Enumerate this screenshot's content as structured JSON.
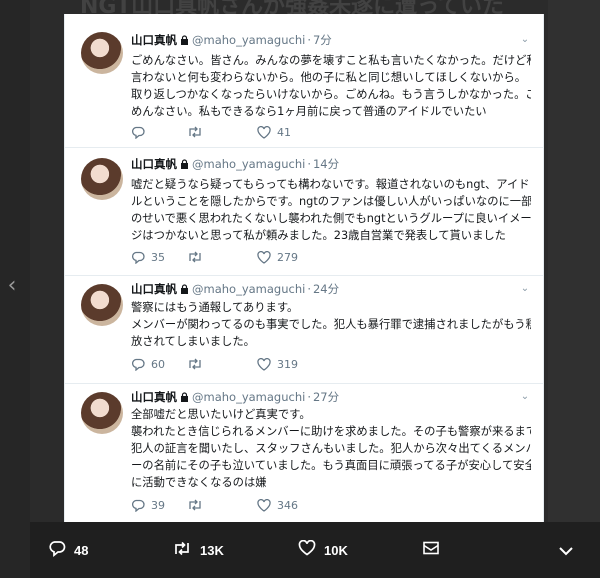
{
  "background": {
    "header_text": "NGT山口真帆さんが強姦未遂に遭っていた"
  },
  "tweets": [
    {
      "name": "山口真帆",
      "handle": "@maho_yamaguchi",
      "time": "7分",
      "lines": [
        "ごめんなさい。皆さん。みんなの夢を壊すこと私も言いたくなかった。だけど私が",
        "言わないと何も変わらないから。他の子に私と同じ想いしてほしくないから。",
        "取り返しつかなくなったらいけないから。ごめんね。もう言うしかなかった。ご",
        "めんなさい。私もできるなら1ヶ月前に戻って普通のアイドルでいたい"
      ],
      "replies": "",
      "retweets": "",
      "likes": "41"
    },
    {
      "name": "山口真帆",
      "handle": "@maho_yamaguchi",
      "time": "14分",
      "lines": [
        "嘘だと疑うなら疑ってもらっても構わないです。報道されないのもngt、アイド",
        "ルということを隠したからです。ngtのファンは優しい人がいっぱいなのに一部",
        "のせいで悪く思われたくないし襲われた側でもngtというグループに良いイメー",
        "ジはつかないと思って私が頼みました。23歳自営業で発表して貰いました"
      ],
      "replies": "35",
      "retweets": "",
      "likes": "279"
    },
    {
      "name": "山口真帆",
      "handle": "@maho_yamaguchi",
      "time": "24分",
      "lines": [
        "警察にはもう通報してあります。",
        "メンバーが関わってるのも事実でした。犯人も暴行罪で逮捕されましたがもう釈",
        "放されてしまいました。"
      ],
      "replies": "60",
      "retweets": "",
      "likes": "319"
    },
    {
      "name": "山口真帆",
      "handle": "@maho_yamaguchi",
      "time": "27分",
      "lines": [
        "全部嘘だと思いたいけど真実です。",
        "襲われたとき信じられるメンバーに助けを求めました。その子も警察が来るまで",
        "犯人の証言を聞いたし、スタッフさんもいました。犯人から次々出てくるメンバ",
        "ーの名前にその子も泣いていました。もう真面目に頑張ってる子が安心して安全",
        "に活動できなくなるのは嫌"
      ],
      "replies": "39",
      "retweets": "",
      "likes": "346"
    }
  ],
  "stats_bar": {
    "replies": "48",
    "retweets": "13K",
    "likes": "10K"
  },
  "icons": {
    "reply": "reply-icon",
    "retweet": "retweet-icon",
    "like": "heart-icon",
    "dm": "envelope-icon",
    "more": "chevron-down-icon",
    "lock": "lock-icon",
    "prev": "chevron-left-icon"
  },
  "colors": {
    "like_heart": "#657786",
    "text_secondary": "#657786",
    "modal_bar": "#1f1f1f"
  }
}
